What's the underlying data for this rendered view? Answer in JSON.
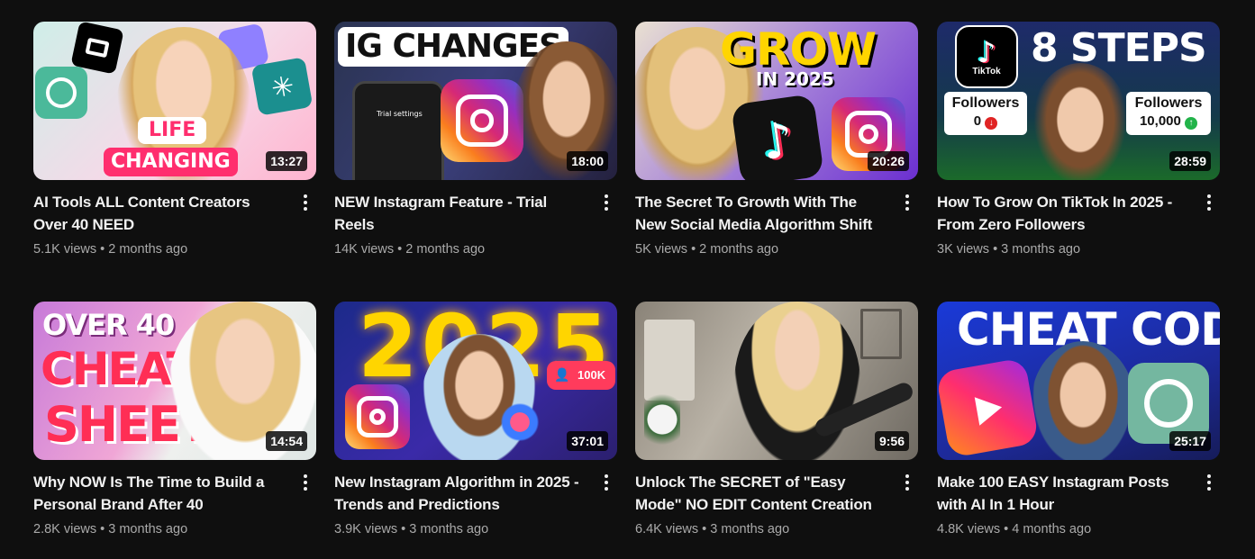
{
  "videos": [
    {
      "title": "AI Tools ALL Content Creators Over 40 NEED",
      "views": "5.1K views",
      "age": "2 months ago",
      "duration": "13:27",
      "thumb_lines": [
        "LIFE",
        "CHANGING"
      ]
    },
    {
      "title": "NEW Instagram Feature - Trial Reels",
      "views": "14K views",
      "age": "2 months ago",
      "duration": "18:00",
      "thumb_lines": [
        "IG CHANGES",
        "Trial settings"
      ]
    },
    {
      "title": "The Secret To Growth With The New Social Media Algorithm Shift",
      "views": "5K views",
      "age": "2 months ago",
      "duration": "20:26",
      "thumb_lines": [
        "GROW",
        "IN 2025"
      ]
    },
    {
      "title": "How To Grow On TikTok In 2025 - From Zero Followers",
      "views": "3K views",
      "age": "3 months ago",
      "duration": "28:59",
      "thumb_lines": [
        "8 STEPS",
        "TikTok",
        "Followers",
        "0",
        "Followers",
        "10,000"
      ]
    },
    {
      "title": "Why NOW Is The Time to Build a Personal Brand After 40",
      "views": "2.8K views",
      "age": "3 months ago",
      "duration": "14:54",
      "thumb_lines": [
        "OVER 40",
        "CHEAT",
        "SHEET"
      ]
    },
    {
      "title": "New Instagram Algorithm in 2025 - Trends and Predictions",
      "views": "3.9K views",
      "age": "3 months ago",
      "duration": "37:01",
      "thumb_lines": [
        "2025",
        "100K"
      ]
    },
    {
      "title": "Unlock The SECRET of \"Easy Mode\" NO EDIT Content Creation",
      "views": "6.4K views",
      "age": "3 months ago",
      "duration": "9:56",
      "thumb_lines": []
    },
    {
      "title": "Make 100 EASY Instagram Posts with AI In 1 Hour",
      "views": "4.8K views",
      "age": "4 months ago",
      "duration": "25:17",
      "thumb_lines": [
        "CHEAT CODE"
      ]
    }
  ],
  "separator": "•",
  "colors": {
    "background": "#0f0f0f",
    "title": "#f1f1f1",
    "meta": "#aaaaaa",
    "accent_pink": "#ff2e6e",
    "accent_yellow": "#ffd500"
  },
  "icons": {
    "more": "more-vert-icon",
    "instagram": "instagram-logo-icon",
    "tiktok": "tiktok-logo-icon"
  }
}
